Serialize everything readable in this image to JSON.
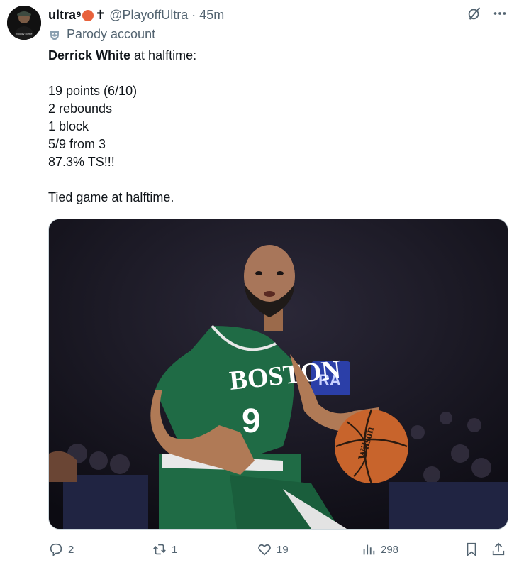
{
  "author": {
    "display_name": "ultra",
    "superscript": "9",
    "cross": "✝",
    "handle": "@PlayoffUltra",
    "separator": "·",
    "time": "45m"
  },
  "label": {
    "text": "Parody account"
  },
  "tweet": {
    "lines": [
      {
        "bold": "Derrick White",
        "text": " at halftime:"
      },
      {
        "text": ""
      },
      {
        "text": "19 points (6/10)"
      },
      {
        "text": "2 rebounds"
      },
      {
        "text": "1 block"
      },
      {
        "text": "5/9 from 3"
      },
      {
        "text": "87.3% TS!!!"
      },
      {
        "text": ""
      },
      {
        "text": "Tied game at halftime."
      }
    ]
  },
  "media": {
    "jersey_team": "BOSTON",
    "jersey_number": "9",
    "ball_brand": "Wilson",
    "board_text": "RA"
  },
  "actions": {
    "replies": "2",
    "reposts": "1",
    "likes": "19",
    "views": "298"
  },
  "colors": {
    "text_primary": "#0f1419",
    "text_secondary": "#536471",
    "jersey_green": "#1f6b45",
    "ball_orange": "#c8642c"
  }
}
